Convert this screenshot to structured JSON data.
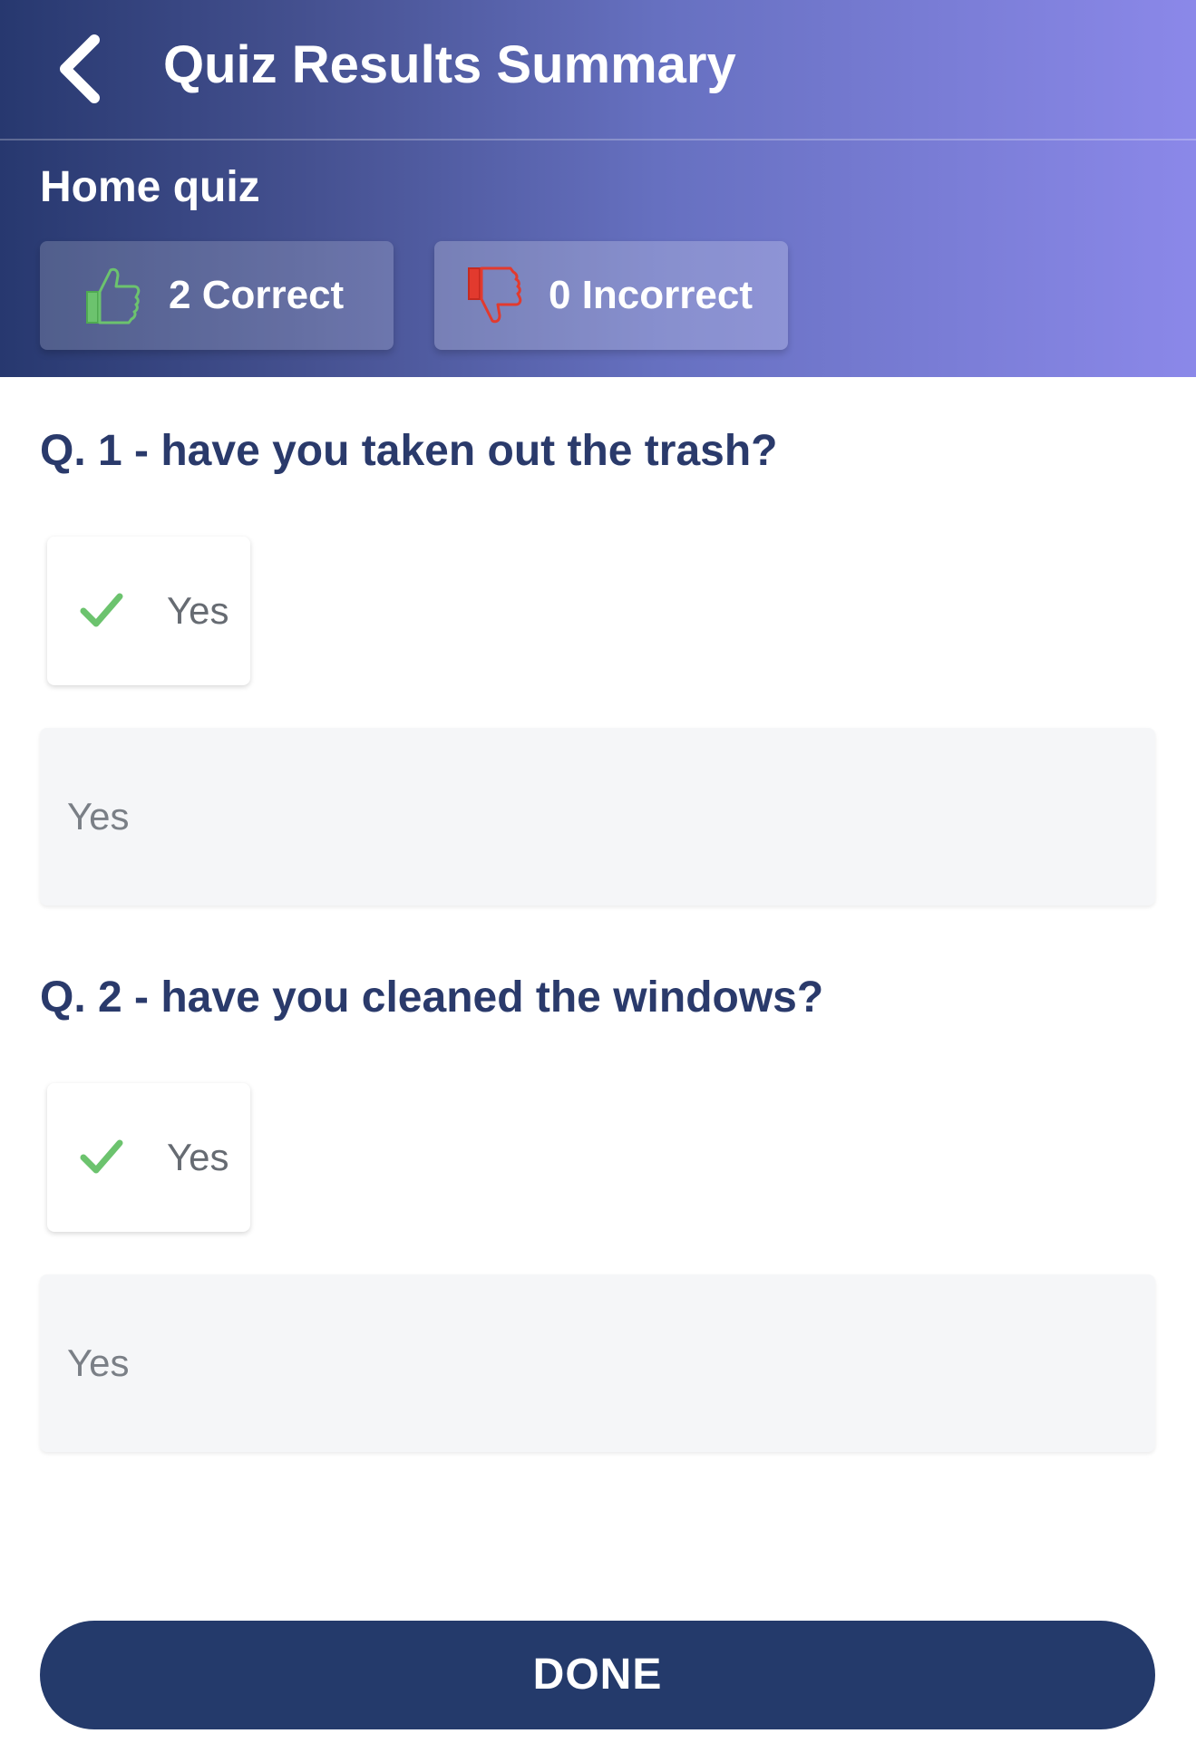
{
  "header": {
    "title": "Quiz Results Summary",
    "quiz_name": "Home quiz",
    "correct_label": "2 Correct",
    "incorrect_label": "0 Incorrect"
  },
  "questions": [
    {
      "question": "Q. 1 - have you taken out the trash?",
      "selected_answer": "Yes",
      "response": "Yes"
    },
    {
      "question": "Q. 2 - have you cleaned the windows?",
      "selected_answer": "Yes",
      "response": "Yes"
    }
  ],
  "footer": {
    "done_label": "DONE"
  },
  "colors": {
    "primary": "#243a6b",
    "correct_green": "#6cc36e",
    "incorrect_red": "#e23a2e"
  },
  "icons": {
    "back": "chevron-left-icon",
    "correct": "thumbs-up-icon",
    "incorrect": "thumbs-down-icon",
    "answer_check": "check-icon"
  }
}
